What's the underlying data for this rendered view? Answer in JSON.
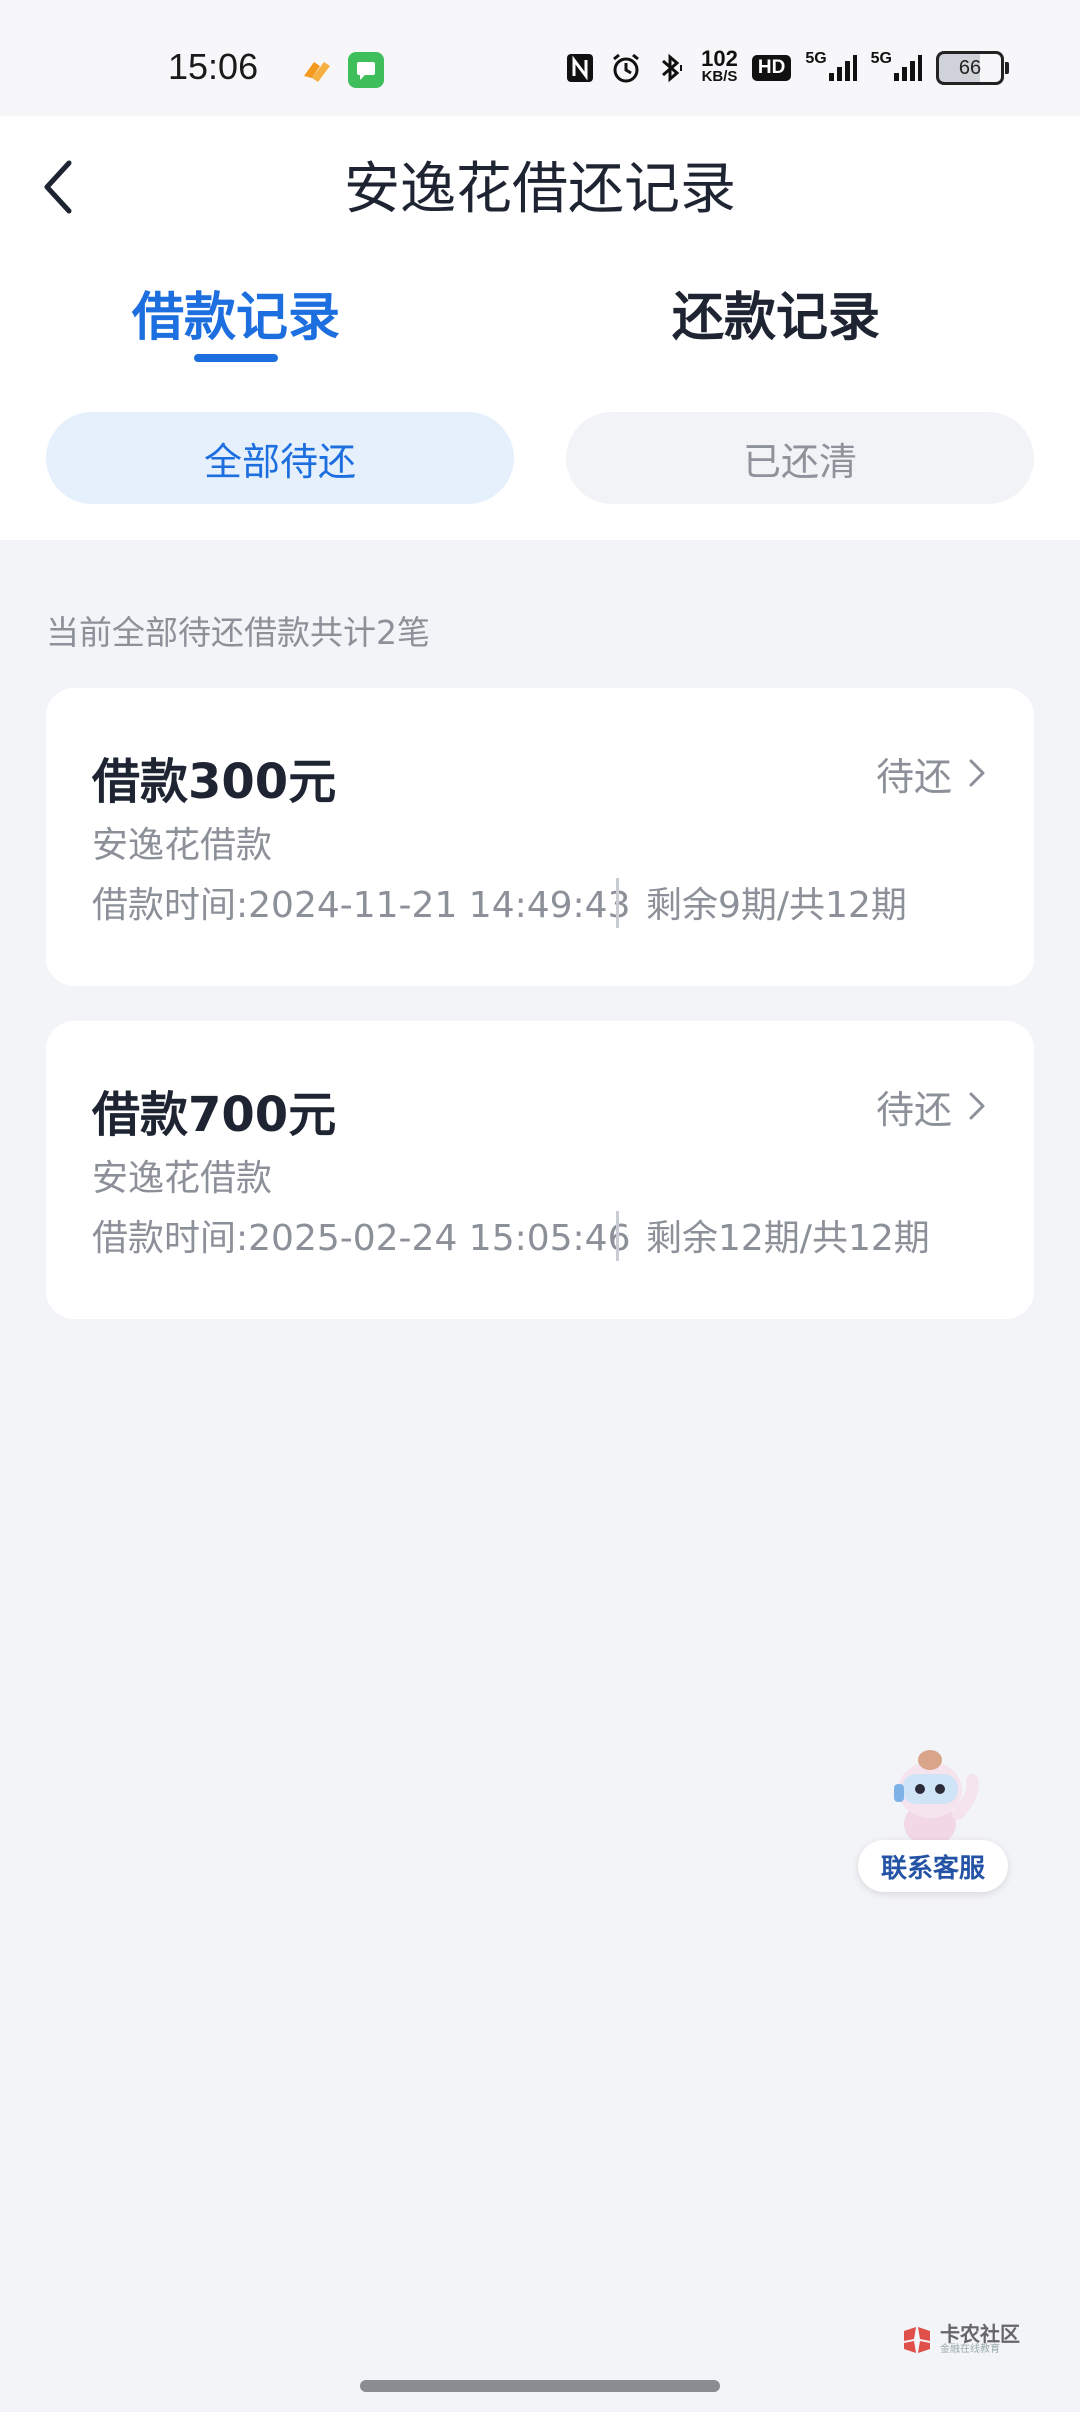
{
  "status_bar": {
    "time": "15:06",
    "network_speed_top": "102",
    "network_speed_unit": "KB/S",
    "hd_label": "HD",
    "signal_1_label": "5G",
    "signal_2_label": "5G",
    "battery_level": "66",
    "nfc_label": "N"
  },
  "header": {
    "title": "安逸花借还记录"
  },
  "tabs": [
    {
      "label": "借款记录",
      "active": true
    },
    {
      "label": "还款记录",
      "active": false
    }
  ],
  "filters": [
    {
      "label": "全部待还",
      "active": true
    },
    {
      "label": "已还清",
      "active": false
    }
  ],
  "summary": "当前全部待还借款共计2笔",
  "loans": [
    {
      "amount": "借款300元",
      "status": "待还",
      "product": "安逸花借款",
      "time": "借款时间:2024-11-21 14:49:43",
      "periods": "剩余9期/共12期"
    },
    {
      "amount": "借款700元",
      "status": "待还",
      "product": "安逸花借款",
      "time": "借款时间:2025-02-24 15:05:46",
      "periods": "剩余12期/共12期"
    }
  ],
  "customer_service": {
    "label": "联系客服"
  },
  "watermark": {
    "main": "卡农社区",
    "sub": "金融在线教育"
  },
  "colors": {
    "accent": "#1d6fe0",
    "page_bg": "#f3f4f7",
    "card_bg": "#ffffff",
    "muted_text": "#8c9099",
    "primary_text": "#1f2433"
  }
}
